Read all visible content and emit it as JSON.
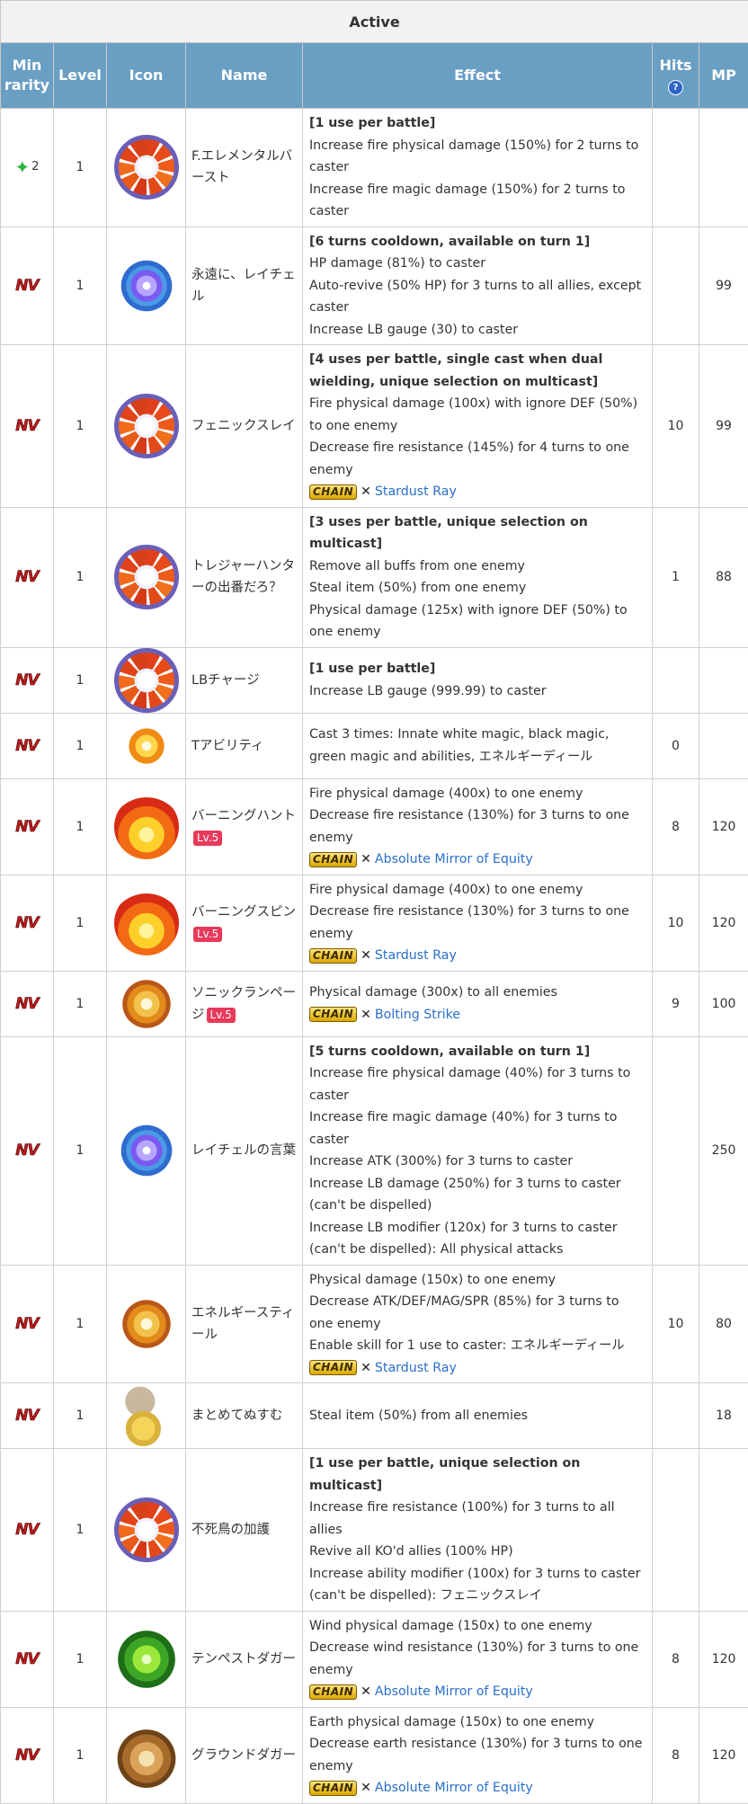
{
  "table_title": "Active",
  "headers": {
    "rarity": "Min rarity",
    "level": "Level",
    "icon": "Icon",
    "name": "Name",
    "effect": "Effect",
    "hits": "Hits",
    "hits_help": "?",
    "mp": "MP"
  },
  "badges": {
    "nv": "NV",
    "star_count": "2",
    "lv5": "Lv.5",
    "chain": "CHAIN",
    "chain_x": "✕"
  },
  "rows": [
    {
      "rarity": "star",
      "level": "1",
      "icon": "ring-icon",
      "name": "F.エレメンタルバースト",
      "lv": "",
      "effect": [
        {
          "t": "[1 use per battle]",
          "b": true
        },
        {
          "t": "Increase fire physical damage (150%) for 2 turns to caster"
        },
        {
          "t": "Increase fire magic damage (150%) for 2 turns to caster"
        }
      ],
      "chain": "",
      "hits": "",
      "mp": ""
    },
    {
      "rarity": "nv",
      "level": "1",
      "icon": "blue-swirl-icon",
      "name": "永遠に、レイチェル",
      "lv": "",
      "effect": [
        {
          "t": "[6 turns cooldown, available on turn 1]",
          "b": true
        },
        {
          "t": "HP damage (81%) to caster"
        },
        {
          "t": "Auto-revive (50% HP) for 3 turns to all allies, except caster"
        },
        {
          "t": "Increase LB gauge (30) to caster"
        }
      ],
      "chain": "",
      "hits": "",
      "mp": "99"
    },
    {
      "rarity": "nv",
      "level": "1",
      "icon": "ring-icon",
      "name": "フェニックスレイ",
      "lv": "",
      "effect": [
        {
          "t": "[4 uses per battle, single cast when dual wielding, unique selection on multicast]",
          "b": true
        },
        {
          "t": "Fire physical damage (100x) with ignore DEF (50%) to one enemy"
        },
        {
          "t": "Decrease fire resistance (145%) for 4 turns to one enemy"
        }
      ],
      "chain": "Stardust Ray",
      "hits": "10",
      "mp": "99"
    },
    {
      "rarity": "nv",
      "level": "1",
      "icon": "ring-icon",
      "name": "トレジャーハンターの出番だろ？",
      "lv": "",
      "effect": [
        {
          "t": "[3 uses per battle, unique selection on multicast]",
          "b": true
        },
        {
          "t": "Remove all buffs from one enemy"
        },
        {
          "t": "Steal item (50%) from one enemy"
        },
        {
          "t": "Physical damage (125x) with ignore DEF (50%) to one enemy"
        }
      ],
      "chain": "",
      "hits": "1",
      "mp": "88"
    },
    {
      "rarity": "nv",
      "level": "1",
      "icon": "ring-icon",
      "name": "LBチャージ",
      "lv": "",
      "effect": [
        {
          "t": "[1 use per battle]",
          "b": true
        },
        {
          "t": "Increase LB gauge (999.99) to caster"
        }
      ],
      "chain": "",
      "hits": "",
      "mp": ""
    },
    {
      "rarity": "nv",
      "level": "1",
      "icon": "burst-icon",
      "name": "Tアビリティ",
      "lv": "",
      "effect": [
        {
          "t": "Cast 3 times: Innate white magic, black magic, green magic and abilities, エネルギーディール"
        }
      ],
      "chain": "",
      "hits": "0",
      "mp": ""
    },
    {
      "rarity": "nv",
      "level": "1",
      "icon": "fire-icon",
      "name": "バーニングハント",
      "lv": "Lv.5",
      "effect": [
        {
          "t": "Fire physical damage (400x) to one enemy"
        },
        {
          "t": "Decrease fire resistance (130%) for 3 turns to one enemy"
        }
      ],
      "chain": "Absolute Mirror of Equity",
      "hits": "8",
      "mp": "120"
    },
    {
      "rarity": "nv",
      "level": "1",
      "icon": "fire-icon",
      "name": "バーニングスピン",
      "lv": "Lv.5",
      "effect": [
        {
          "t": "Fire physical damage (400x) to one enemy"
        },
        {
          "t": "Decrease fire resistance (130%) for 3 turns to one enemy"
        }
      ],
      "chain": "Stardust Ray",
      "hits": "10",
      "mp": "120"
    },
    {
      "rarity": "nv",
      "level": "1",
      "icon": "explosion-icon",
      "name": "ソニックランページ",
      "lv": "Lv.5",
      "effect": [
        {
          "t": "Physical damage (300x) to all enemies"
        }
      ],
      "chain": "Bolting Strike",
      "hits": "9",
      "mp": "100"
    },
    {
      "rarity": "nv",
      "level": "1",
      "icon": "blue-swirl-icon",
      "name": "レイチェルの言葉",
      "lv": "",
      "effect": [
        {
          "t": "[5 turns cooldown, available on turn 1]",
          "b": true
        },
        {
          "t": "Increase fire physical damage (40%) for 3 turns to caster"
        },
        {
          "t": "Increase fire magic damage (40%) for 3 turns to caster"
        },
        {
          "t": "Increase ATK (300%) for 3 turns to caster"
        },
        {
          "t": "Increase LB damage (250%) for 3 turns to caster (can't be dispelled)"
        },
        {
          "t": "Increase LB modifier (120x) for 3 turns to caster (can't be dispelled): All physical attacks"
        }
      ],
      "chain": "",
      "hits": "",
      "mp": "250"
    },
    {
      "rarity": "nv",
      "level": "1",
      "icon": "explosion-icon",
      "name": "エネルギースティール",
      "lv": "",
      "effect": [
        {
          "t": "Physical damage (150x) to one enemy"
        },
        {
          "t": "Decrease ATK/DEF/MAG/SPR (85%) for 3 turns to one enemy"
        },
        {
          "t": "Enable skill for 1 use to caster: エネルギーディール"
        }
      ],
      "chain": "Stardust Ray",
      "hits": "10",
      "mp": "80"
    },
    {
      "rarity": "nv",
      "level": "1",
      "icon": "thief-icon",
      "name": "まとめてぬすむ",
      "lv": "",
      "effect": [
        {
          "t": "Steal item (50%) from all enemies"
        }
      ],
      "chain": "",
      "hits": "",
      "mp": "18"
    },
    {
      "rarity": "nv",
      "level": "1",
      "icon": "ring-icon",
      "name": "不死鳥の加護",
      "lv": "",
      "effect": [
        {
          "t": "[1 use per battle, unique selection on multicast]",
          "b": true
        },
        {
          "t": "Increase fire resistance (100%) for 3 turns to all allies"
        },
        {
          "t": "Revive all KO'd allies (100% HP)"
        },
        {
          "t": "Increase ability modifier (100x) for 3 turns to caster (can't be dispelled): フェニックスレイ"
        }
      ],
      "chain": "",
      "hits": "",
      "mp": ""
    },
    {
      "rarity": "nv",
      "level": "1",
      "icon": "wind-icon",
      "name": "テンペストダガー",
      "lv": "",
      "effect": [
        {
          "t": "Wind physical damage (150x) to one enemy"
        },
        {
          "t": "Decrease wind resistance (130%) for 3 turns to one enemy"
        }
      ],
      "chain": "Absolute Mirror of Equity",
      "hits": "8",
      "mp": "120"
    },
    {
      "rarity": "nv",
      "level": "1",
      "icon": "earth-icon",
      "name": "グラウンドダガー",
      "lv": "",
      "effect": [
        {
          "t": "Earth physical damage (150x) to one enemy"
        },
        {
          "t": "Decrease earth resistance (130%) for 3 turns to one enemy"
        }
      ],
      "chain": "Absolute Mirror of Equity",
      "hits": "8",
      "mp": "120"
    }
  ],
  "colors": {
    "header_bg": "#6a9fc4",
    "title_bg": "#f2f2f2",
    "link": "#2a6fc9",
    "nv_red": "#c21a1a",
    "lv_badge": "#e83a5b",
    "star_green": "#2bb43e"
  }
}
